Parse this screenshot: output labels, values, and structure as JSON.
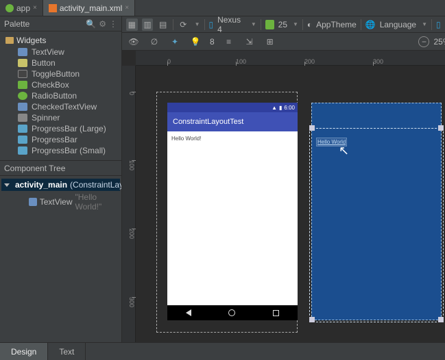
{
  "tabs": {
    "app": "app",
    "file": "activity_main.xml"
  },
  "palette": {
    "title": "Palette",
    "group": "Widgets",
    "items": [
      {
        "label": "TextView",
        "cls": "txt"
      },
      {
        "label": "Button",
        "cls": "btn"
      },
      {
        "label": "ToggleButton",
        "cls": "tgl"
      },
      {
        "label": "CheckBox",
        "cls": "chk"
      },
      {
        "label": "RadioButton",
        "cls": "rad"
      },
      {
        "label": "CheckedTextView",
        "cls": "chktxt"
      },
      {
        "label": "Spinner",
        "cls": "spn"
      },
      {
        "label": "ProgressBar (Large)",
        "cls": "prog"
      },
      {
        "label": "ProgressBar",
        "cls": "prog"
      },
      {
        "label": "ProgressBar (Small)",
        "cls": "prog"
      }
    ]
  },
  "componentTree": {
    "title": "Component Tree",
    "root": {
      "name": "activity_main",
      "type": "(ConstraintLayout)"
    },
    "child": {
      "name": "TextView",
      "value": "\"Hello World!\""
    }
  },
  "designToolbar": {
    "device": "Nexus 4",
    "api": "25",
    "theme": "AppTheme",
    "lang": "Language"
  },
  "designToolbar2": {
    "margin": "8",
    "zoom": "25%"
  },
  "ruler": {
    "h": [
      "0",
      "100",
      "200",
      "300"
    ],
    "v": [
      "0",
      "100",
      "200",
      "300"
    ]
  },
  "preview": {
    "appTitle": "ConstraintLayoutTest",
    "bodyText": "Hello World!",
    "clock": "6:00"
  },
  "blueprint": {
    "tv": "Hello World"
  },
  "bottomTabs": {
    "design": "Design",
    "text": "Text"
  }
}
